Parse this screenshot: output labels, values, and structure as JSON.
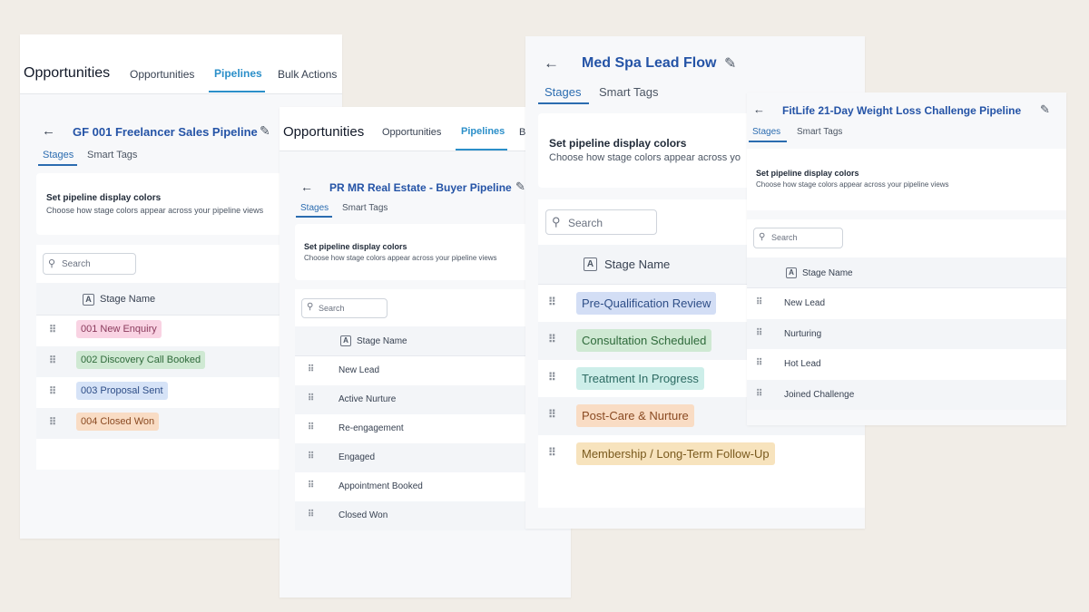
{
  "panels": {
    "gf": {
      "app_title": "Opportunities",
      "tabs": [
        "Opportunities",
        "Pipelines",
        "Bulk Actions"
      ],
      "pipeline_title": "GF 001 Freelancer Sales Pipeline",
      "subtabs": [
        "Stages",
        "Smart Tags"
      ],
      "display_title": "Set pipeline display colors",
      "display_desc": "Choose how stage colors appear across your pipeline views",
      "search_placeholder": "Search",
      "column_header": "Stage Name",
      "stages": [
        "001 New Enquiry",
        "002 Discovery Call Booked",
        "003 Proposal Sent",
        "004 Closed Won"
      ],
      "stage_colors": [
        "#f9d3e3",
        "#cfe9d3",
        "#d6e3f7",
        "#f9dcc4"
      ]
    },
    "pr": {
      "app_title": "Opportunities",
      "tabs": [
        "Opportunities",
        "Pipelines",
        "B"
      ],
      "pipeline_title": "PR MR Real Estate - Buyer Pipeline",
      "subtabs": [
        "Stages",
        "Smart Tags"
      ],
      "display_title": "Set pipeline display colors",
      "display_desc": "Choose how stage colors appear across your pipeline views",
      "search_placeholder": "Search",
      "column_header": "Stage Name",
      "stages": [
        "New Lead",
        "Active Nurture",
        "Re-engagement",
        "Engaged",
        "Appointment Booked",
        "Closed Won"
      ]
    },
    "med": {
      "pipeline_title": "Med Spa Lead Flow",
      "subtabs": [
        "Stages",
        "Smart Tags"
      ],
      "display_title": "Set pipeline display colors",
      "display_desc": "Choose how stage colors appear across yo",
      "search_placeholder": "Search",
      "column_header": "Stage Name",
      "stages": [
        "Pre-Qualification Review",
        "Consultation Scheduled",
        "Treatment In Progress",
        "Post-Care & Nurture",
        "Membership / Long-Term Follow-Up"
      ],
      "stage_colors": [
        "#d3def5",
        "#cfe9d3",
        "#cdeee9",
        "#f9dcc4",
        "#f7e3bd"
      ]
    },
    "fit": {
      "pipeline_title": "FitLife 21-Day Weight Loss Challenge Pipeline",
      "subtabs": [
        "Stages",
        "Smart Tags"
      ],
      "display_title": "Set pipeline display colors",
      "display_desc": "Choose how stage colors appear across your pipeline views",
      "search_placeholder": "Search",
      "column_header": "Stage Name",
      "stages": [
        "New Lead",
        "Nurturing",
        "Hot Lead",
        "Joined Challenge"
      ]
    }
  },
  "icons": {
    "back": "back-arrow-icon",
    "edit": "pencil-icon",
    "search": "search-icon",
    "column": "text-column-icon",
    "drag": "drag-handle-icon"
  },
  "colors": {
    "accent": "#2b8fc9",
    "title": "#2453a6",
    "background": "#f1ede7"
  }
}
